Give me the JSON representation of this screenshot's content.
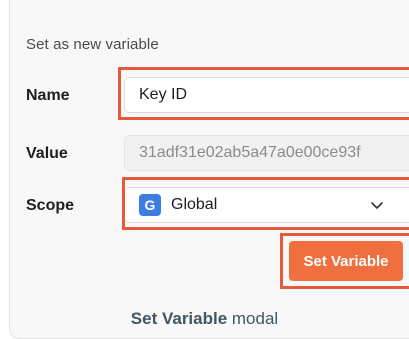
{
  "modal": {
    "heading": "Set as new variable",
    "name_label": "Name",
    "name_value": "Key ID",
    "value_label": "Value",
    "value_value": "31adf31e02ab5a47a0e00ce93f",
    "scope_label": "Scope",
    "scope_badge": "G",
    "scope_value": "Global",
    "submit_label": "Set Variable"
  },
  "caption": {
    "bold": "Set Variable",
    "rest": " modal"
  },
  "colors": {
    "accent_button": "#ef6f3e",
    "highlight_border": "#e55a3c",
    "scope_badge": "#3b7de0"
  },
  "icons": {
    "scope_dropdown": "chevron-down-icon"
  }
}
